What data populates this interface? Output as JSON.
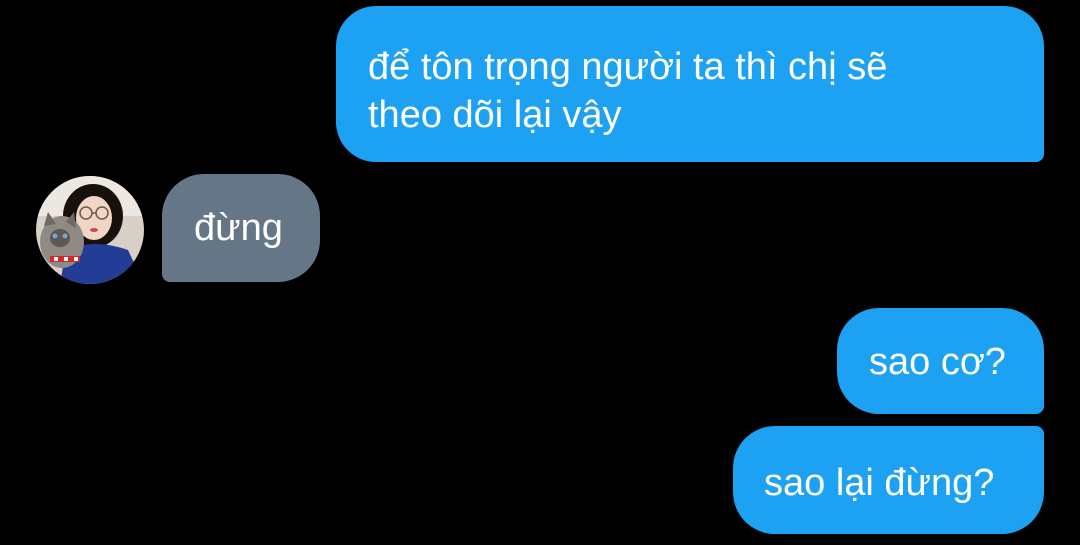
{
  "conversation": {
    "messages": [
      {
        "direction": "outgoing",
        "lines": [
          "để tôn trọng người ta thì chị sẽ",
          "theo dõi lại vậy"
        ]
      },
      {
        "direction": "incoming",
        "text": "đừng"
      },
      {
        "direction": "outgoing",
        "text": "sao cơ?"
      },
      {
        "direction": "outgoing",
        "text": "sao lại đừng?"
      }
    ]
  },
  "colors": {
    "background": "#000000",
    "outgoing_bubble": "#1da1f2",
    "incoming_bubble": "#657786",
    "text": "#ffffff"
  },
  "icons": {
    "avatar": "contact-avatar-photo"
  }
}
